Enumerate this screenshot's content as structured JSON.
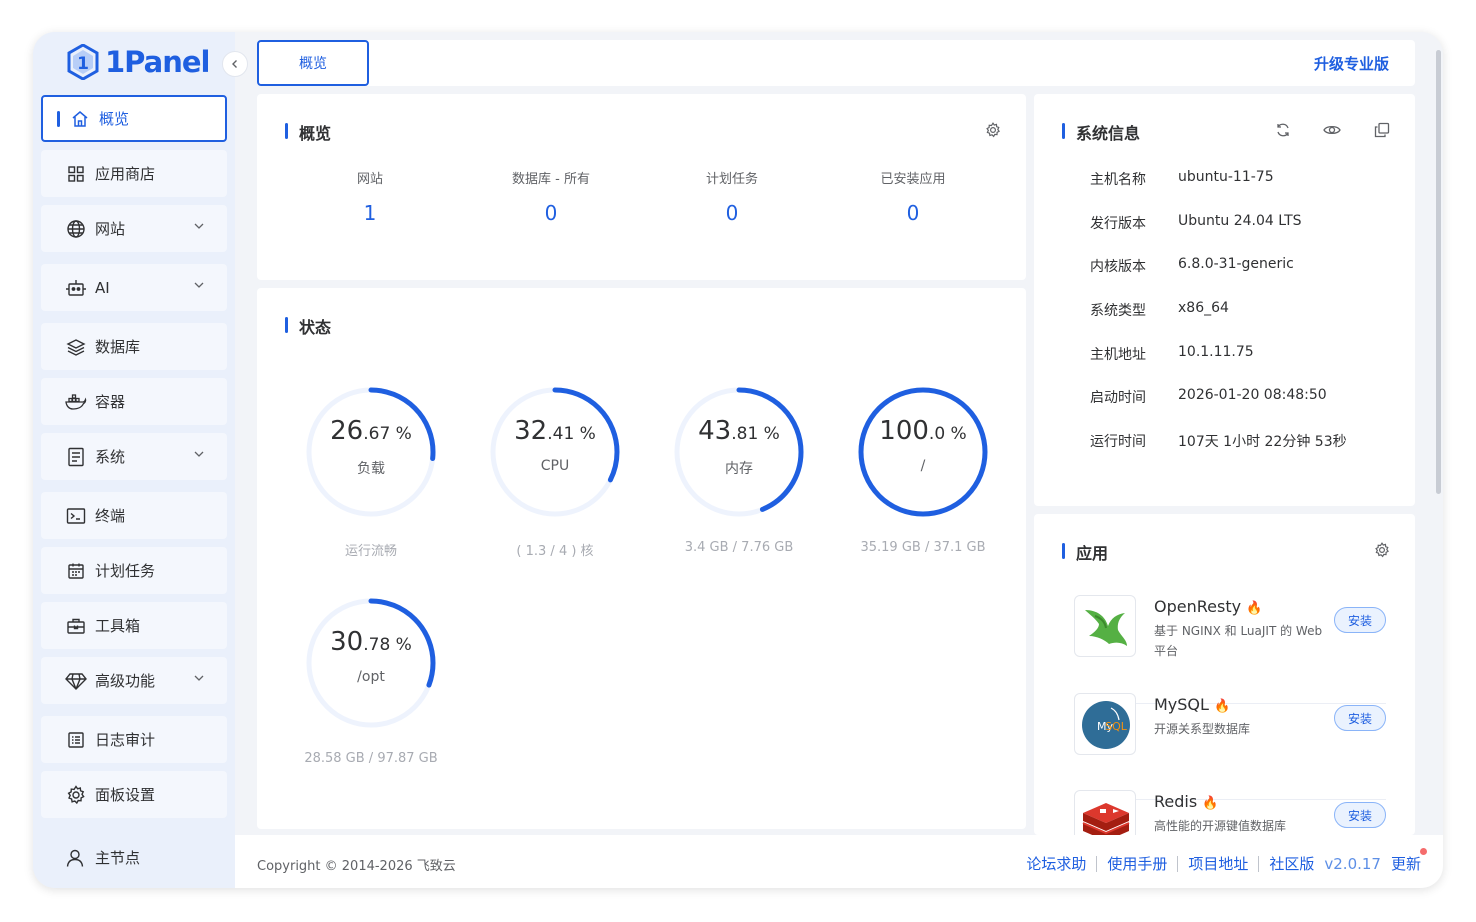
{
  "brand": {
    "name": "1Panel"
  },
  "topbar": {
    "active_tab": "概览",
    "upgrade_label": "升级专业版"
  },
  "sidebar": {
    "items": [
      {
        "label": "概览",
        "icon": "home-icon",
        "active": true,
        "expandable": false
      },
      {
        "label": "应用商店",
        "icon": "grid-icon",
        "active": false,
        "expandable": false
      },
      {
        "label": "网站",
        "icon": "globe-icon",
        "active": false,
        "expandable": true
      },
      {
        "label": "AI",
        "icon": "robot-icon",
        "active": false,
        "expandable": true
      },
      {
        "label": "数据库",
        "icon": "layers-icon",
        "active": false,
        "expandable": false
      },
      {
        "label": "容器",
        "icon": "docker-icon",
        "active": false,
        "expandable": false
      },
      {
        "label": "系统",
        "icon": "file-list-icon",
        "active": false,
        "expandable": true
      },
      {
        "label": "终端",
        "icon": "terminal-icon",
        "active": false,
        "expandable": false
      },
      {
        "label": "计划任务",
        "icon": "calendar-icon",
        "active": false,
        "expandable": false
      },
      {
        "label": "工具箱",
        "icon": "toolbox-icon",
        "active": false,
        "expandable": false
      },
      {
        "label": "高级功能",
        "icon": "diamond-icon",
        "active": false,
        "expandable": true
      },
      {
        "label": "日志审计",
        "icon": "log-icon",
        "active": false,
        "expandable": false
      },
      {
        "label": "面板设置",
        "icon": "settings-icon",
        "active": false,
        "expandable": false
      }
    ],
    "node_label": "主节点"
  },
  "overview": {
    "title": "概览",
    "stats": [
      {
        "label": "网站",
        "value": "1"
      },
      {
        "label": "数据库 - 所有",
        "value": "0"
      },
      {
        "label": "计划任务",
        "value": "0"
      },
      {
        "label": "已安装应用",
        "value": "0"
      }
    ]
  },
  "status": {
    "title": "状态",
    "gauges": [
      {
        "int": "26",
        "dec": ".67",
        "unit": " %",
        "percent": 26.67,
        "label": "负载",
        "sub": "运行流畅"
      },
      {
        "int": "32",
        "dec": ".41",
        "unit": " %",
        "percent": 32.41,
        "label": "CPU",
        "sub": "( 1.3 / 4 ) 核"
      },
      {
        "int": "43",
        "dec": ".81",
        "unit": " %",
        "percent": 43.81,
        "label": "内存",
        "sub": "3.4 GB / 7.76 GB"
      },
      {
        "int": "100",
        "dec": ".0",
        "unit": " %",
        "percent": 100.0,
        "label": "/",
        "sub": "35.19 GB / 37.1 GB"
      },
      {
        "int": "30",
        "dec": ".78",
        "unit": " %",
        "percent": 30.78,
        "label": "/opt",
        "sub": "28.58 GB / 97.87 GB"
      }
    ]
  },
  "system_info": {
    "title": "系统信息",
    "rows": [
      {
        "key": "主机名称",
        "value": "ubuntu-11-75"
      },
      {
        "key": "发行版本",
        "value": "Ubuntu 24.04 LTS"
      },
      {
        "key": "内核版本",
        "value": "6.8.0-31-generic"
      },
      {
        "key": "系统类型",
        "value": "x86_64"
      },
      {
        "key": "主机地址",
        "value": "10.1.11.75"
      },
      {
        "key": "启动时间",
        "value": "2026-01-20 08:48:50"
      },
      {
        "key": "运行时间",
        "value": "107天 1小时 22分钟 53秒"
      }
    ]
  },
  "apps": {
    "title": "应用",
    "items": [
      {
        "name": "OpenResty",
        "desc": "基于 NGINX 和 LuaJIT 的 Web 平台",
        "button": "安装"
      },
      {
        "name": "MySQL",
        "desc": "开源关系型数据库",
        "button": "安装"
      },
      {
        "name": "Redis",
        "desc": "高性能的开源键值数据库",
        "button": "安装"
      }
    ]
  },
  "footer": {
    "copyright": "Copyright © 2014-2026 飞致云",
    "links": [
      "论坛求助",
      "使用手册",
      "项目地址",
      "社区版"
    ],
    "version": "v2.0.17",
    "update_label": "更新"
  },
  "colors": {
    "accent": "#1f5fe0",
    "gauge_track": "#eef3fd"
  }
}
